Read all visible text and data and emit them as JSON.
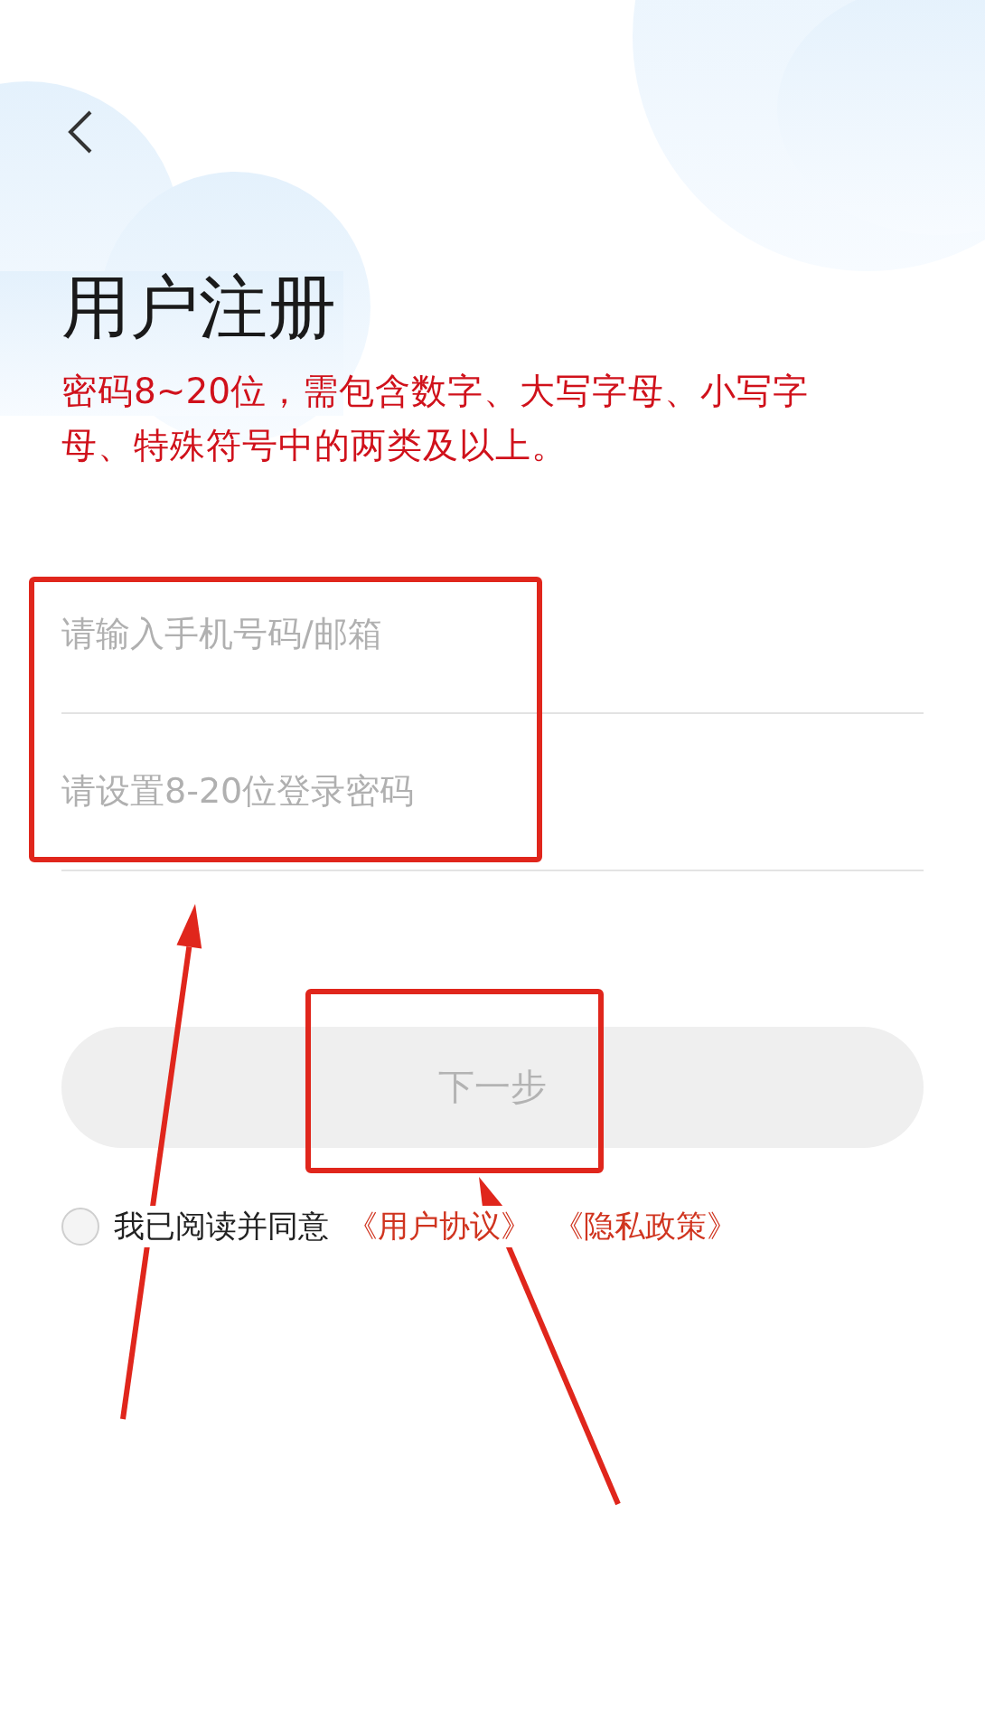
{
  "title": "用户注册",
  "hint": "密码8~20位，需包含数字、大写字母、小写字母、特殊符号中的两类及以上。",
  "fields": [
    {
      "placeholder": "请输入手机号码/邮箱"
    },
    {
      "placeholder": "请设置8-20位登录密码"
    }
  ],
  "next_button": {
    "label": "下一步",
    "disabled": true
  },
  "agreement": {
    "checked": false,
    "text": "我已阅读并同意",
    "links": [
      "《用户协议》",
      "《隐私政策》"
    ]
  },
  "annotations": [
    {
      "kind": "box"
    },
    {
      "kind": "box"
    },
    {
      "kind": "arrow"
    },
    {
      "kind": "arrow"
    }
  ]
}
